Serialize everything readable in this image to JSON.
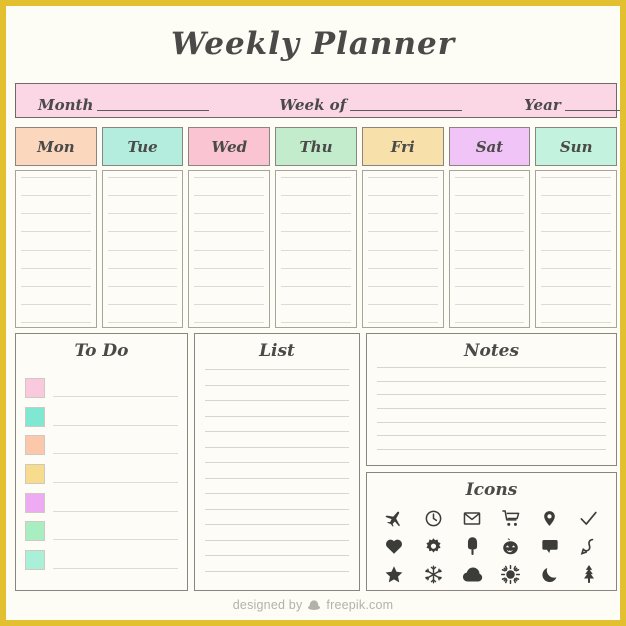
{
  "page": {
    "title": "Weekly Planner",
    "border_color": "#e3c02f",
    "background_color": "#fdfcf5",
    "ink_color": "#4a4a48"
  },
  "date_bar": {
    "background_color": "#fbd6e5",
    "fields": [
      {
        "label": "Month"
      },
      {
        "label": "Week of"
      },
      {
        "label": "Year"
      }
    ]
  },
  "days": [
    {
      "label": "Mon",
      "color": "#fbd7bd",
      "lines": 9
    },
    {
      "label": "Tue",
      "color": "#b4ecdd",
      "lines": 9
    },
    {
      "label": "Wed",
      "color": "#fbc4d2",
      "lines": 9
    },
    {
      "label": "Thu",
      "color": "#c2eccb",
      "lines": 9
    },
    {
      "label": "Fri",
      "color": "#f8e0aa",
      "lines": 9
    },
    {
      "label": "Sat",
      "color": "#f0c4f6",
      "lines": 9
    },
    {
      "label": "Sun",
      "color": "#c3f2de",
      "lines": 9
    }
  ],
  "todo": {
    "title": "To Do",
    "rows": [
      {
        "color": "#fbc9dd"
      },
      {
        "color": "#7fe8d2"
      },
      {
        "color": "#fbc8ac"
      },
      {
        "color": "#f8dc8e"
      },
      {
        "color": "#eeaaf2"
      },
      {
        "color": "#a8eec0"
      },
      {
        "color": "#aaf0d8"
      }
    ]
  },
  "list": {
    "title": "List",
    "lines": 14
  },
  "notes": {
    "title": "Notes",
    "lines": 7
  },
  "icons": {
    "title": "Icons",
    "items": [
      {
        "name": "airplane-icon"
      },
      {
        "name": "clock-icon"
      },
      {
        "name": "envelope-icon"
      },
      {
        "name": "shopping-cart-icon"
      },
      {
        "name": "location-pin-icon"
      },
      {
        "name": "checkmark-icon"
      },
      {
        "name": "heart-icon"
      },
      {
        "name": "gear-icon"
      },
      {
        "name": "popsicle-icon"
      },
      {
        "name": "pumpkin-icon"
      },
      {
        "name": "speech-bubble-icon"
      },
      {
        "name": "phone-icon"
      },
      {
        "name": "star-icon"
      },
      {
        "name": "snowflake-icon"
      },
      {
        "name": "cloud-icon"
      },
      {
        "name": "sun-icon"
      },
      {
        "name": "moon-icon"
      },
      {
        "name": "tree-icon"
      }
    ]
  },
  "footer": {
    "text_before": "designed by",
    "text_after": "freepik.com"
  }
}
